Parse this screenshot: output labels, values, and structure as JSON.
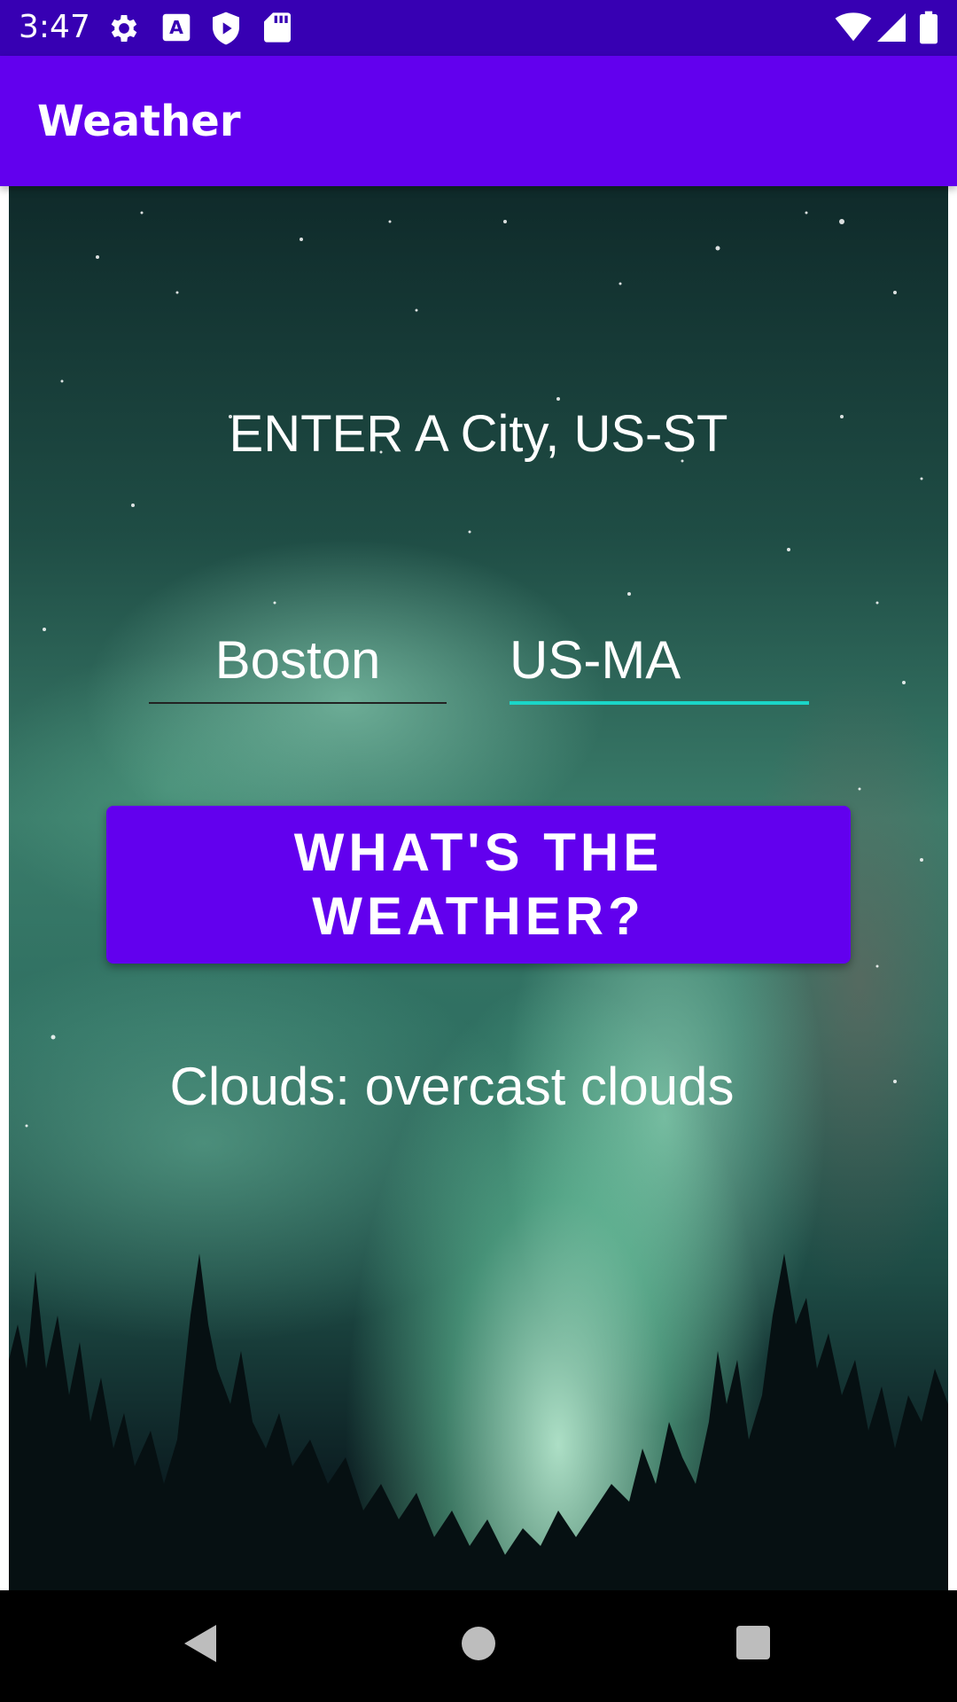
{
  "status_bar": {
    "time": "3:47",
    "left_icons": [
      "settings-icon",
      "keyboard-a-icon",
      "shield-play-icon",
      "sd-card-icon"
    ],
    "right_icons": [
      "wifi-icon",
      "cell-signal-icon",
      "battery-icon"
    ]
  },
  "app_bar": {
    "title": "Weather"
  },
  "main": {
    "prompt": "ENTER A City, US-ST",
    "city_input": {
      "value": "Boston"
    },
    "state_input": {
      "value": "US-MA"
    },
    "submit_button": {
      "label": "WHAT'S THE WEATHER?"
    },
    "result": "Clouds: overcast clouds"
  },
  "nav_bar": {
    "icons": [
      "back-icon",
      "home-icon",
      "recents-icon"
    ]
  },
  "colors": {
    "status_bar": "#3700b3",
    "primary": "#6200ee",
    "accent": "#1ad6c8"
  }
}
